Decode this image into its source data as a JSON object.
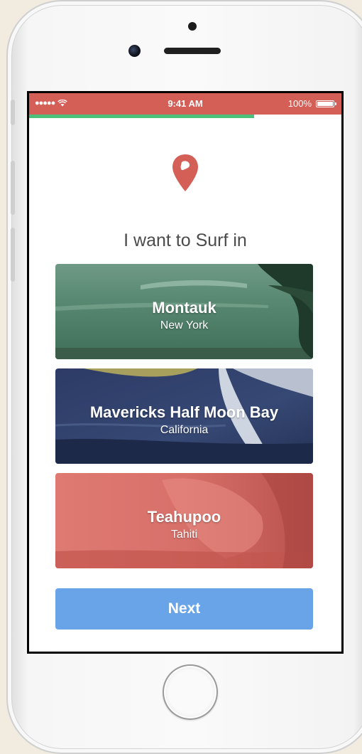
{
  "status_bar": {
    "signal": "●●●●●",
    "time": "9:41 AM",
    "battery": "100%"
  },
  "progress": {
    "fraction": 0.72,
    "color": "#4cbf78"
  },
  "colors": {
    "status_bar": "#d45f57",
    "pin": "#d45f57",
    "next_button": "#6aa4e8"
  },
  "heading": "I want to Surf in",
  "locations": [
    {
      "name": "Montauk",
      "region": "New York"
    },
    {
      "name": "Mavericks Half Moon Bay",
      "region": "California"
    },
    {
      "name": "Teahupoo",
      "region": "Tahiti"
    }
  ],
  "next_label": "Next"
}
